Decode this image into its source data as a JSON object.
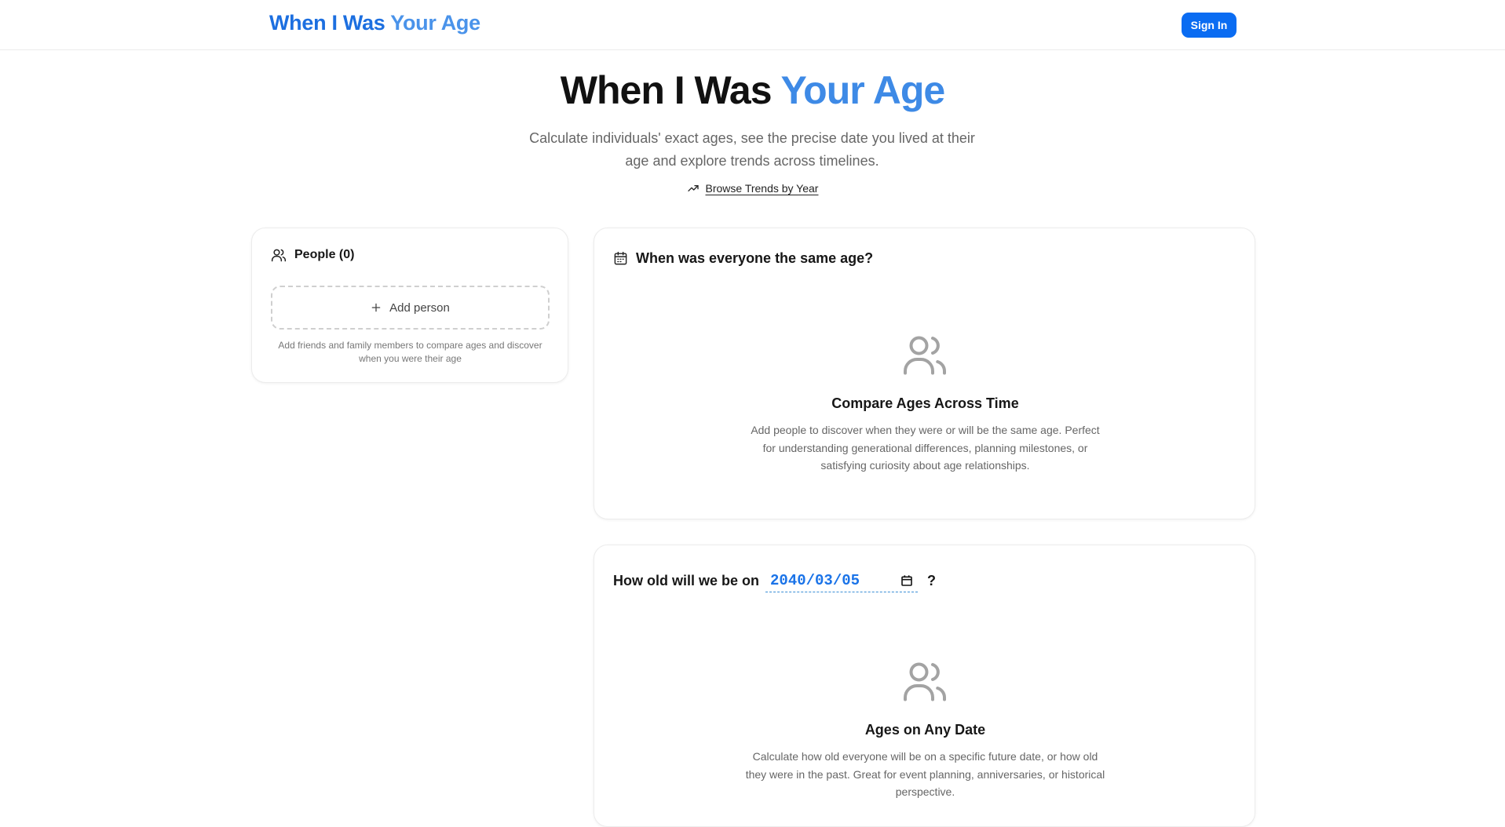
{
  "header": {
    "brand_main": "When I Was",
    "brand_accent": "Your Age",
    "signin_label": "Sign In",
    "brand_color": "#1c6fe0",
    "signin_color": "#0a6cf2"
  },
  "hero": {
    "title_main": "When I Was",
    "title_accent": "Your Age",
    "subtitle": "Calculate individuals' exact ages, see the precise date you lived at their age and explore trends across timelines.",
    "trends_link": "Browse Trends by Year",
    "trends_icon": "trending-up-icon"
  },
  "people": {
    "title": "People (0)",
    "icon": "users-icon",
    "add_label": "Add person",
    "add_icon": "plus-icon",
    "hint": "Add friends and family members to compare ages and discover when you were their age"
  },
  "same_age": {
    "title": "When was everyone the same age?",
    "icon": "calendar-icon",
    "empty_icon": "users-icon",
    "empty_title": "Compare Ages Across Time",
    "empty_desc": "Add people to discover when they were or will be the same age. Perfect for understanding generational differences, planning milestones, or satisfying curiosity about age relationships."
  },
  "on_date": {
    "prefix": "How old will we be on",
    "date_value": "2040/03/05",
    "date_icon": "calendar-picker-icon",
    "suffix": "?",
    "empty_icon": "users-icon",
    "empty_title": "Ages on Any Date",
    "empty_desc": "Calculate how old everyone will be on a specific future date, or how old they were in the past. Great for event planning, anniversaries, or historical perspective."
  }
}
